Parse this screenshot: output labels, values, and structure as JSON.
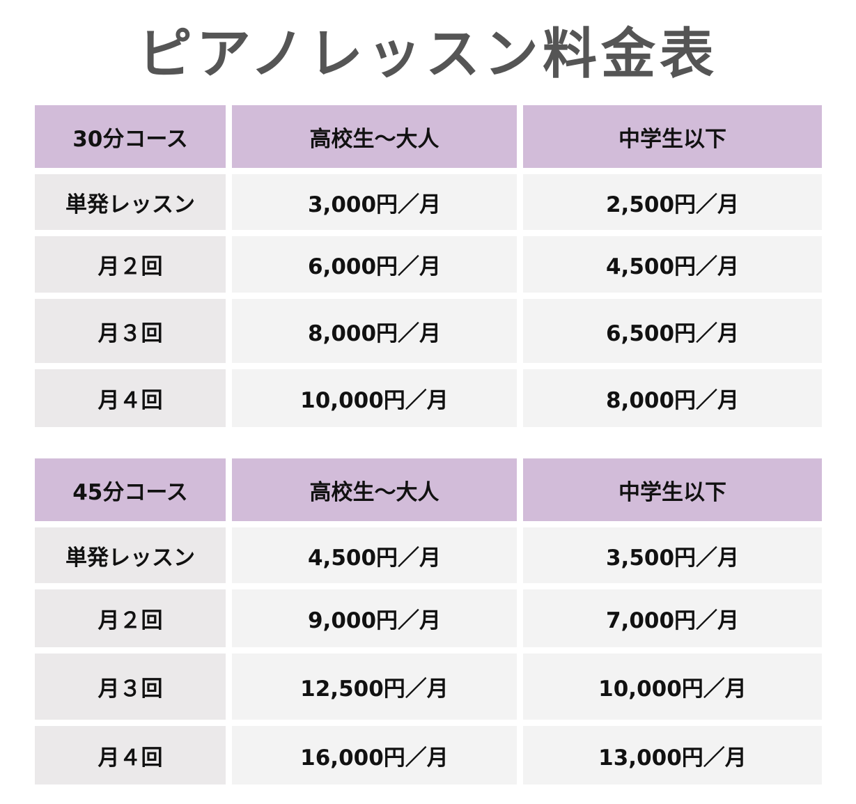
{
  "title": "ピアノレッスン料金表",
  "colors": {
    "header_bg": "#d2bcd9",
    "label_bg": "#ebe9ea",
    "cell_bg": "#f3f3f3",
    "title_color": "#555555"
  },
  "tables": [
    {
      "header": [
        "30分コース",
        "高校生〜大人",
        "中学生以下"
      ],
      "rows": [
        [
          "単発レッスン",
          "3,000円／月",
          "2,500円／月"
        ],
        [
          "月２回",
          "6,000円／月",
          "4,500円／月"
        ],
        [
          "月３回",
          "8,000円／月",
          "6,500円／月"
        ],
        [
          "月４回",
          "10,000円／月",
          "8,000円／月"
        ]
      ]
    },
    {
      "header": [
        "45分コース",
        "高校生〜大人",
        "中学生以下"
      ],
      "rows": [
        [
          "単発レッスン",
          "4,500円／月",
          "3,500円／月"
        ],
        [
          "月２回",
          "9,000円／月",
          "7,000円／月"
        ],
        [
          "月３回",
          "12,500円／月",
          "10,000円／月"
        ],
        [
          "月４回",
          "16,000円／月",
          "13,000円／月"
        ]
      ]
    }
  ]
}
